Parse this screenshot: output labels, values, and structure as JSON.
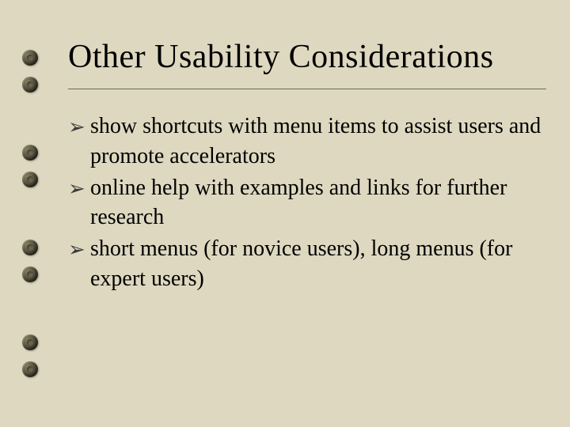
{
  "slide": {
    "title": "Other Usability Considerations",
    "bullets": [
      "show shortcuts with menu items to assist users and promote accelerators",
      "online help with examples and links for further research",
      "short menus (for novice users), long menus (for expert users)"
    ],
    "bullet_marker": "➢"
  }
}
